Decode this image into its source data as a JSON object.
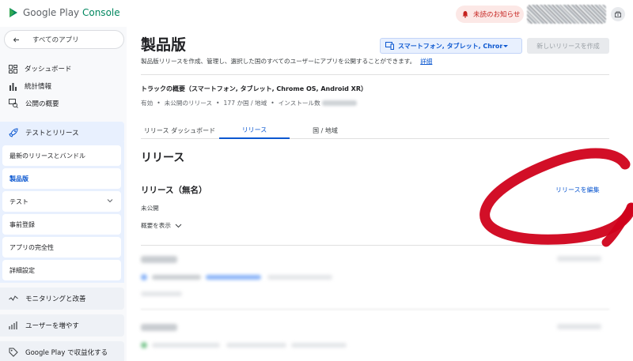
{
  "header": {
    "brand": "Google Play",
    "brand_accent": "Console",
    "notification_label": "未読のお知らせ",
    "colors": {
      "brand_green": "#01875f",
      "alert_red": "#c5221f",
      "link_blue": "#0b57d0"
    }
  },
  "sidebar": {
    "back_label": "すべてのアプリ",
    "top_items": [
      {
        "label": "ダッシュボード",
        "icon": "dashboard-icon"
      },
      {
        "label": "統計情報",
        "icon": "bar-chart-icon"
      },
      {
        "label": "公開の概要",
        "icon": "publishing-overview-icon"
      }
    ],
    "test_release": {
      "label": "テストとリリース",
      "icon": "rocket-icon"
    },
    "sub_items": [
      {
        "label": "最新のリリースとバンドル"
      },
      {
        "label": "製品版"
      },
      {
        "label": "テスト"
      },
      {
        "label": "事前登録"
      },
      {
        "label": "アプリの完全性"
      },
      {
        "label": "詳細設定"
      }
    ],
    "bottom_sections": [
      {
        "label": "モニタリングと改善",
        "icon": "monitoring-icon"
      },
      {
        "label": "ユーザーを増やす",
        "icon": "grow-users-icon"
      },
      {
        "label": "Google Play で収益化する",
        "icon": "monetize-tag-icon"
      }
    ]
  },
  "main": {
    "title": "製品版",
    "device_selector": "スマートフォン, タブレット, Chrome...",
    "new_release_button": "新しいリリースを作成",
    "description": "製品版リリースを作成、管理し、選択した国のすべてのユーザーにアプリを公開することができます。",
    "details_link": "詳細",
    "track_overview": {
      "title": "トラックの概要（スマートフォン, タブレット, Chrome OS, Android XR）",
      "meta": [
        "有効",
        "未公開のリリース",
        "177 か国 / 地域",
        "インストール数"
      ]
    },
    "tabs": [
      {
        "label": "リリース ダッシュボード"
      },
      {
        "label": "リリース"
      },
      {
        "label": "国 / 地域"
      }
    ],
    "section_title": "リリース",
    "release": {
      "title": "リリース（無名）",
      "edit_link": "リリースを編集",
      "status": "未公開",
      "summary_toggle": "概要を表示"
    }
  }
}
